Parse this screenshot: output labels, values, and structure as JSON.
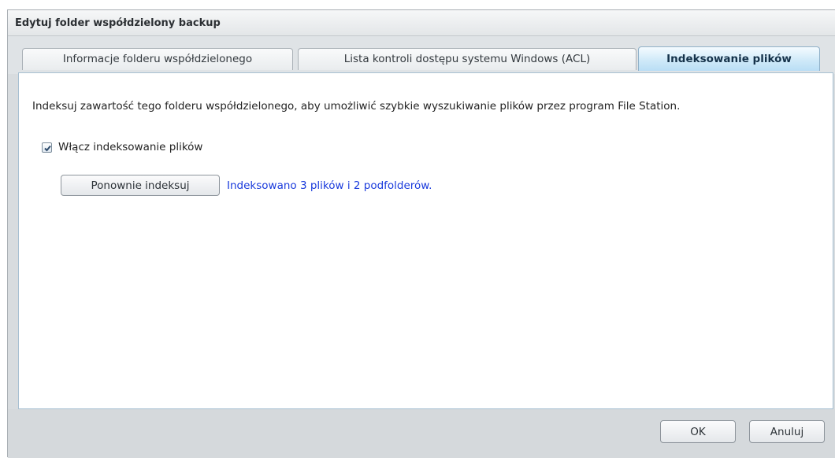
{
  "dialog": {
    "title": "Edytuj folder współdzielony backup"
  },
  "tabs": [
    {
      "label": "Informacje folderu współdzielonego",
      "active": false
    },
    {
      "label": "Lista kontroli dostępu systemu Windows (ACL)",
      "active": false
    },
    {
      "label": "Indeksowanie plików",
      "active": true
    }
  ],
  "panel": {
    "description": "Indeksuj zawartość tego folderu współdzielonego, aby umożliwić szybkie wyszukiwanie plików przez program File Station.",
    "enable_indexing": {
      "label": "Włącz indeksowanie plików",
      "checked": true
    },
    "reindex_button": "Ponownie indeksuj",
    "status_text": "Indeksowano 3 plików i 2 podfolderów.",
    "status_color": "#1a3bdc"
  },
  "footer": {
    "ok_label": "OK",
    "cancel_label": "Anuluj"
  },
  "colors": {
    "active_tab": "#cde8f8",
    "panel_border": "#a7c0d2",
    "dialog_bg": "#d8dcdf"
  }
}
